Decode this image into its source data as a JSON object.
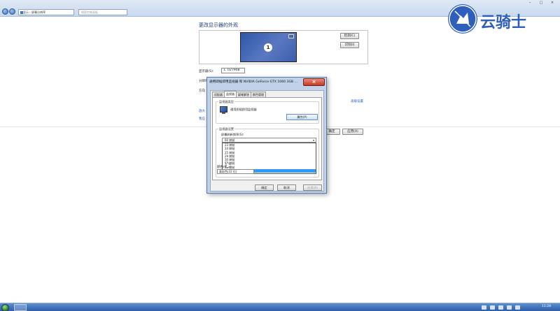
{
  "explorer": {
    "breadcrumb": "显示 › 屏幕分辨率",
    "search_placeholder": "搜索控制面板",
    "minimize": "–",
    "maximize": "□",
    "close": "×"
  },
  "page": {
    "title": "更改显示器的外观",
    "monitor_number": "1",
    "detect_button": "检测(C)",
    "identify_button": "识别(I)",
    "display_label": "显示器(S):",
    "display_value": "1. U2790B",
    "resolution_label": "分辨率",
    "orientation_label": "方向",
    "advanced_link": "高级设置",
    "link_1": "放大",
    "link_2": "我应",
    "ok_button": "确定",
    "apply_button": "应用(A)"
  },
  "dialog": {
    "title": "通用即插即用监视器 和 NVIDIA GeForce GTX 1060 3GB ...",
    "close": "×",
    "tabs": [
      "适配器",
      "监视器",
      "疑难解答",
      "颜色管理"
    ],
    "monitor_type_group": "监视器类型",
    "monitor_name": "通用即插即用监视器",
    "properties_button": "属性(P)",
    "settings_group": "监视器设置",
    "refresh_rate_label": "屏幕刷新频率(S):",
    "refresh_rate_value": "60 赫兹",
    "refresh_rate_options": [
      "23 赫兹",
      "24 赫兹",
      "25 赫兹",
      "29 赫兹",
      "30 赫兹",
      "50 赫兹",
      "59 赫兹",
      "60 赫兹"
    ],
    "selected_option_index": 7,
    "colors_label": "颜色(C):",
    "colors_value": "真彩色(32 位)",
    "ok_button": "确定",
    "cancel_button": "取消",
    "apply_button": "应用(A)"
  },
  "watermark": {
    "text": "云骑士"
  },
  "taskbar": {
    "clock": "11:28"
  }
}
